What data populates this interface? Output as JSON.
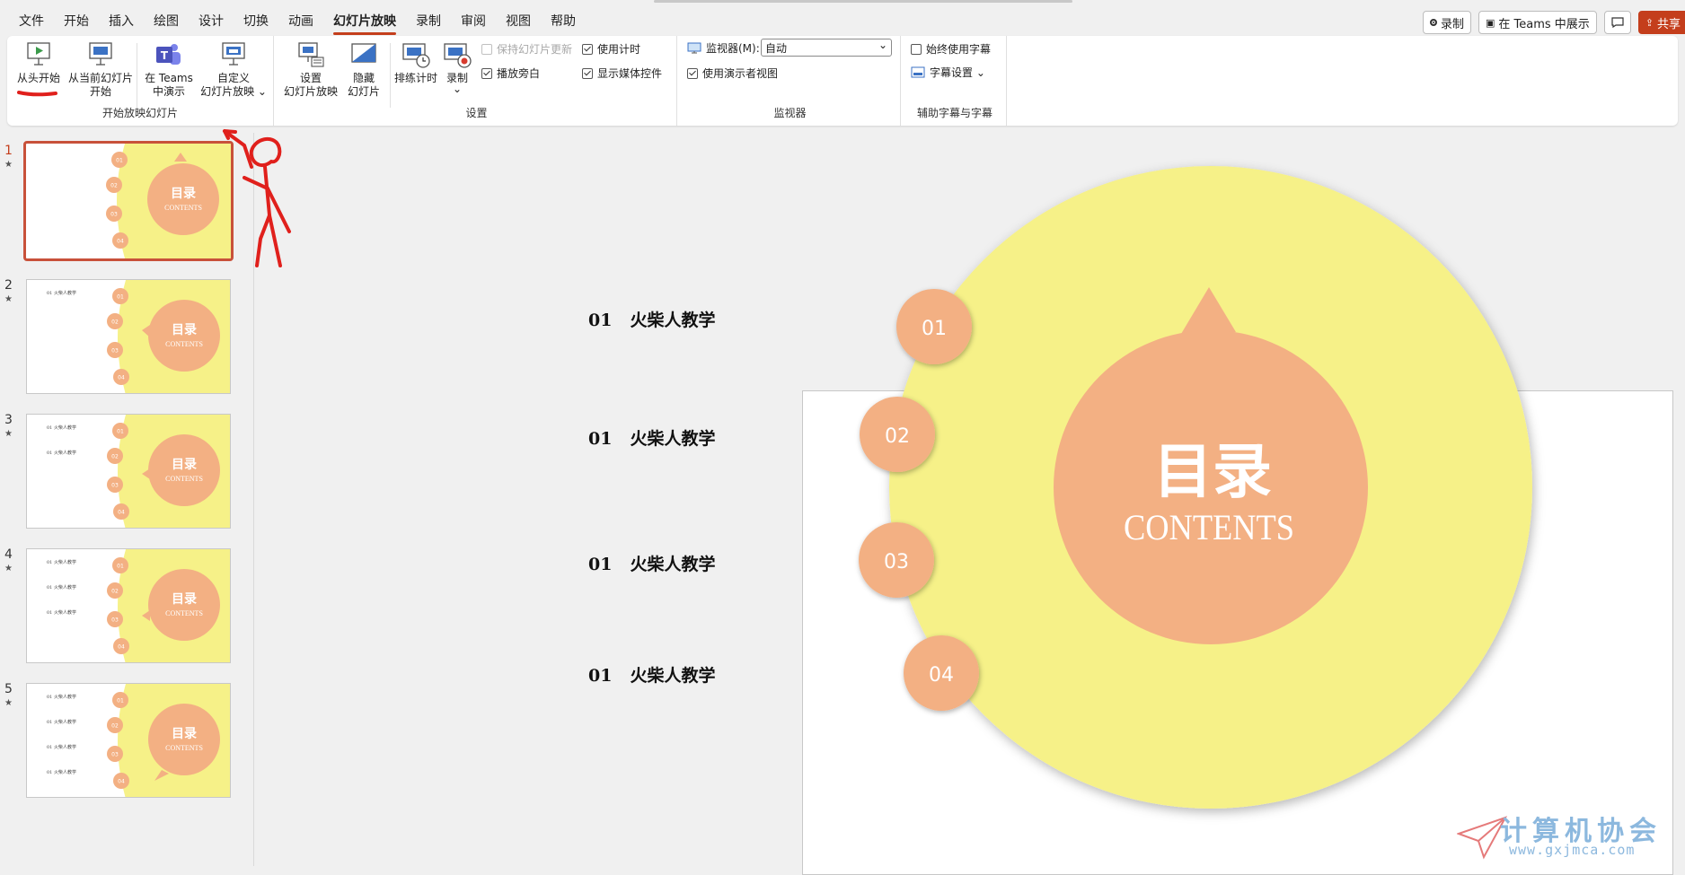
{
  "menu": {
    "tabs": [
      "文件",
      "开始",
      "插入",
      "绘图",
      "设计",
      "切换",
      "动画",
      "幻灯片放映",
      "录制",
      "审阅",
      "视图",
      "帮助"
    ],
    "active_tab": "幻灯片放映"
  },
  "top_actions": {
    "record": "录制",
    "teams_present": "在 Teams 中展示",
    "comment_icon": "comment-icon",
    "share": "共享"
  },
  "ribbon": {
    "start_group": {
      "label": "开始放映幻灯片",
      "from_beginning": "从头开始",
      "from_current_l1": "从当前幻灯片",
      "from_current_l2": "开始",
      "teams_l1": "在 Teams",
      "teams_l2": "中演示",
      "custom_l1": "自定义",
      "custom_l2": "幻灯片放映 ⌄"
    },
    "setup_group": {
      "label": "设置",
      "setup_l1": "设置",
      "setup_l2": "幻灯片放映",
      "hide_l1": "隐藏",
      "hide_l2": "幻灯片",
      "rehearse": "排练计时",
      "record": "录制",
      "record_arrow": "⌄",
      "keep_updated": "保持幻灯片更新",
      "play_narration": "播放旁白",
      "use_timings": "使用计时",
      "show_media": "显示媒体控件"
    },
    "monitor_group": {
      "label": "监视器",
      "monitor_label": "监视器(M):",
      "monitor_value": "自动",
      "presenter_view": "使用演示者视图"
    },
    "caption_group": {
      "label": "辅助字幕与字幕",
      "always_subtitles": "始终使用字幕",
      "subtitle_settings": "字幕设置 ⌄"
    }
  },
  "slides": [
    {
      "num": "1",
      "star": "★",
      "items": 0
    },
    {
      "num": "2",
      "star": "★",
      "items": 1
    },
    {
      "num": "3",
      "star": "★",
      "items": 2
    },
    {
      "num": "4",
      "star": "★",
      "items": 3
    },
    {
      "num": "5",
      "star": "★",
      "items": 4
    }
  ],
  "thumb_text": {
    "title": "目录",
    "subtitle": "CONTENTS",
    "item": "01  火柴人教学",
    "badges": [
      "01",
      "02",
      "03",
      "04"
    ]
  },
  "main_slide": {
    "toc": [
      {
        "num": "01",
        "text": "火柴人教学"
      },
      {
        "num": "01",
        "text": "火柴人教学"
      },
      {
        "num": "01",
        "text": "火柴人教学"
      },
      {
        "num": "01",
        "text": "火柴人教学"
      }
    ],
    "badges": [
      "01",
      "02",
      "03",
      "04"
    ],
    "title": "目录",
    "subtitle": "CONTENTS"
  },
  "watermark": {
    "title": "计算机协会",
    "url": "www.gxjmca.com"
  },
  "colors": {
    "yellow": "#f6f188",
    "salmon": "#f3b083",
    "accent": "#c43e1c",
    "annotation": "#e0201c"
  }
}
